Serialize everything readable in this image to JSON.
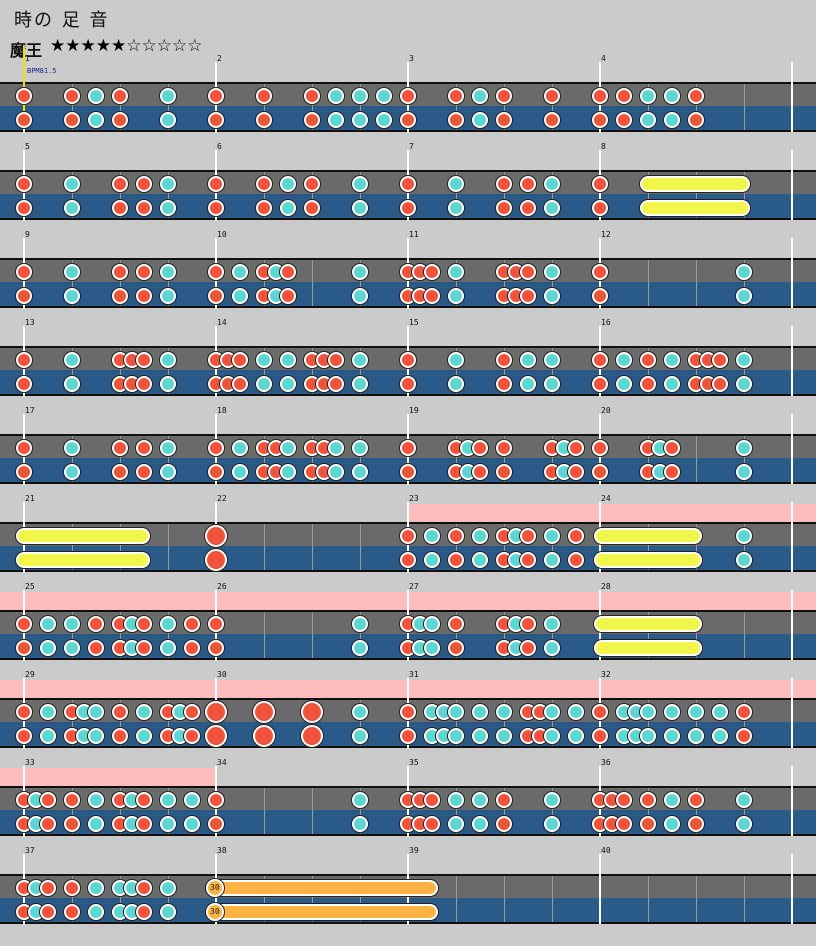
{
  "header": {
    "title": "時の 足 音",
    "difficulty": "魔王",
    "stars": "★★★★★☆☆☆☆☆"
  },
  "bpm_label": "BPM81.5",
  "balloon_label": "30",
  "colors": {
    "don": "#f0533c",
    "ka": "#5dd6d2",
    "roll": "#f2f54a",
    "balloon": "#fbb443",
    "gogo": "#fdbcbc"
  },
  "rows": [
    {
      "measures": [
        1,
        2,
        3,
        4
      ],
      "gogo": [],
      "notes": [
        [
          "d",
          24
        ],
        [
          "d",
          72
        ],
        [
          "k",
          96
        ],
        [
          "d",
          120
        ],
        [
          "k",
          168
        ],
        [
          "d",
          216
        ],
        [
          "d",
          264
        ],
        [
          "d",
          312
        ],
        [
          "k",
          336
        ],
        [
          "k",
          360
        ],
        [
          "k",
          384
        ],
        [
          "d",
          408
        ],
        [
          "d",
          456
        ],
        [
          "k",
          480
        ],
        [
          "d",
          504
        ],
        [
          "d",
          552
        ],
        [
          "d",
          600
        ],
        [
          "d",
          624
        ],
        [
          "k",
          648
        ],
        [
          "k",
          672
        ],
        [
          "d",
          696
        ]
      ],
      "rolls": [],
      "bignotes": []
    },
    {
      "measures": [
        5,
        6,
        7,
        8
      ],
      "gogo": [],
      "notes": [
        [
          "d",
          24
        ],
        [
          "k",
          72
        ],
        [
          "d",
          120
        ],
        [
          "d",
          144
        ],
        [
          "k",
          168
        ],
        [
          "d",
          216
        ],
        [
          "d",
          264
        ],
        [
          "k",
          288
        ],
        [
          "d",
          312
        ],
        [
          "k",
          360
        ],
        [
          "d",
          408
        ],
        [
          "k",
          456
        ],
        [
          "d",
          504
        ],
        [
          "d",
          528
        ],
        [
          "k",
          552
        ],
        [
          "d",
          600
        ]
      ],
      "rolls": [
        [
          "yellow",
          640,
          750
        ]
      ],
      "bignotes": []
    },
    {
      "measures": [
        9,
        10,
        11,
        12
      ],
      "gogo": [],
      "notes": [
        [
          "d",
          24
        ],
        [
          "k",
          72
        ],
        [
          "d",
          120
        ],
        [
          "d",
          144
        ],
        [
          "k",
          168
        ],
        [
          "d",
          216
        ],
        [
          "k",
          240
        ],
        [
          "d",
          264
        ],
        [
          "k",
          276
        ],
        [
          "d",
          288
        ],
        [
          "k",
          360
        ],
        [
          "d",
          408
        ],
        [
          "d",
          420
        ],
        [
          "d",
          432
        ],
        [
          "k",
          456
        ],
        [
          "d",
          504
        ],
        [
          "d",
          516
        ],
        [
          "d",
          528
        ],
        [
          "k",
          552
        ],
        [
          "d",
          600
        ],
        [
          "k",
          744
        ]
      ],
      "rolls": [],
      "bignotes": []
    },
    {
      "measures": [
        13,
        14,
        15,
        16
      ],
      "gogo": [],
      "notes": [
        [
          "d",
          24
        ],
        [
          "k",
          72
        ],
        [
          "d",
          120
        ],
        [
          "d",
          132
        ],
        [
          "d",
          144
        ],
        [
          "k",
          168
        ],
        [
          "d",
          216
        ],
        [
          "d",
          228
        ],
        [
          "d",
          240
        ],
        [
          "k",
          264
        ],
        [
          "k",
          288
        ],
        [
          "d",
          312
        ],
        [
          "d",
          324
        ],
        [
          "d",
          336
        ],
        [
          "k",
          360
        ],
        [
          "d",
          408
        ],
        [
          "k",
          456
        ],
        [
          "d",
          504
        ],
        [
          "k",
          528
        ],
        [
          "k",
          552
        ],
        [
          "d",
          600
        ],
        [
          "k",
          624
        ],
        [
          "d",
          648
        ],
        [
          "k",
          672
        ],
        [
          "d",
          696
        ],
        [
          "d",
          708
        ],
        [
          "d",
          720
        ],
        [
          "k",
          744
        ]
      ],
      "rolls": [],
      "bignotes": []
    },
    {
      "measures": [
        17,
        18,
        19,
        20
      ],
      "gogo": [],
      "notes": [
        [
          "d",
          24
        ],
        [
          "k",
          72
        ],
        [
          "d",
          120
        ],
        [
          "d",
          144
        ],
        [
          "k",
          168
        ],
        [
          "d",
          216
        ],
        [
          "k",
          240
        ],
        [
          "d",
          264
        ],
        [
          "d",
          276
        ],
        [
          "k",
          288
        ],
        [
          "d",
          312
        ],
        [
          "d",
          324
        ],
        [
          "k",
          336
        ],
        [
          "k",
          360
        ],
        [
          "d",
          408
        ],
        [
          "d",
          456
        ],
        [
          "k",
          468
        ],
        [
          "d",
          480
        ],
        [
          "d",
          504
        ],
        [
          "d",
          552
        ],
        [
          "k",
          564
        ],
        [
          "d",
          576
        ],
        [
          "d",
          600
        ],
        [
          "d",
          648
        ],
        [
          "k",
          660
        ],
        [
          "d",
          672
        ],
        [
          "k",
          744
        ]
      ],
      "rolls": [],
      "bignotes": []
    },
    {
      "measures": [
        21,
        22,
        23,
        24
      ],
      "gogo": [
        [
          408,
          816
        ]
      ],
      "notes": [
        [
          "d",
          408
        ],
        [
          "k",
          432
        ],
        [
          "d",
          456
        ],
        [
          "k",
          480
        ],
        [
          "d",
          504
        ],
        [
          "k",
          516
        ],
        [
          "d",
          528
        ],
        [
          "k",
          552
        ],
        [
          "d",
          576
        ],
        [
          "k",
          744
        ]
      ],
      "rolls": [
        [
          "yellow",
          16,
          150
        ],
        [
          "yellow",
          594,
          702
        ]
      ],
      "bignotes": [
        [
          "d",
          216
        ]
      ]
    },
    {
      "measures": [
        25,
        26,
        27,
        28
      ],
      "gogo": [
        [
          0,
          816
        ]
      ],
      "notes": [
        [
          "d",
          24
        ],
        [
          "k",
          48
        ],
        [
          "k",
          72
        ],
        [
          "d",
          96
        ],
        [
          "d",
          120
        ],
        [
          "k",
          132
        ],
        [
          "d",
          144
        ],
        [
          "k",
          168
        ],
        [
          "d",
          192
        ],
        [
          "d",
          216
        ],
        [
          "k",
          360
        ],
        [
          "d",
          408
        ],
        [
          "k",
          420
        ],
        [
          "k",
          432
        ],
        [
          "d",
          456
        ],
        [
          "d",
          504
        ],
        [
          "k",
          516
        ],
        [
          "d",
          528
        ],
        [
          "k",
          552
        ]
      ],
      "rolls": [
        [
          "yellow",
          594,
          702
        ]
      ],
      "bignotes": []
    },
    {
      "measures": [
        29,
        30,
        31,
        32
      ],
      "gogo": [
        [
          0,
          816
        ]
      ],
      "notes": [
        [
          "d",
          24
        ],
        [
          "k",
          48
        ],
        [
          "d",
          72
        ],
        [
          "k",
          84
        ],
        [
          "k",
          96
        ],
        [
          "d",
          120
        ],
        [
          "k",
          144
        ],
        [
          "d",
          168
        ],
        [
          "k",
          180
        ],
        [
          "d",
          192
        ],
        [
          "k",
          360
        ],
        [
          "d",
          408
        ],
        [
          "k",
          432
        ],
        [
          "k",
          444
        ],
        [
          "k",
          456
        ],
        [
          "k",
          480
        ],
        [
          "k",
          504
        ],
        [
          "d",
          528
        ],
        [
          "d",
          540
        ],
        [
          "k",
          552
        ],
        [
          "k",
          576
        ],
        [
          "d",
          600
        ],
        [
          "k",
          624
        ],
        [
          "k",
          636
        ],
        [
          "k",
          648
        ],
        [
          "k",
          672
        ],
        [
          "k",
          696
        ],
        [
          "k",
          720
        ],
        [
          "d",
          744
        ]
      ],
      "rolls": [],
      "bignotes": [
        [
          "d",
          216
        ],
        [
          "d",
          264
        ],
        [
          "d",
          312
        ]
      ]
    },
    {
      "measures": [
        33,
        34,
        35,
        36
      ],
      "gogo": [
        [
          0,
          216
        ]
      ],
      "notes": [
        [
          "d",
          24
        ],
        [
          "k",
          36
        ],
        [
          "d",
          48
        ],
        [
          "d",
          72
        ],
        [
          "k",
          96
        ],
        [
          "d",
          120
        ],
        [
          "k",
          132
        ],
        [
          "d",
          144
        ],
        [
          "k",
          168
        ],
        [
          "k",
          192
        ],
        [
          "d",
          216
        ],
        [
          "k",
          360
        ],
        [
          "d",
          408
        ],
        [
          "d",
          420
        ],
        [
          "d",
          432
        ],
        [
          "k",
          456
        ],
        [
          "k",
          480
        ],
        [
          "d",
          504
        ],
        [
          "k",
          552
        ],
        [
          "d",
          600
        ],
        [
          "d",
          612
        ],
        [
          "d",
          624
        ],
        [
          "d",
          648
        ],
        [
          "k",
          672
        ],
        [
          "d",
          696
        ],
        [
          "k",
          744
        ]
      ],
      "rolls": [],
      "bignotes": []
    },
    {
      "measures": [
        37,
        38,
        39,
        40
      ],
      "gogo": [],
      "notes": [
        [
          "d",
          24
        ],
        [
          "k",
          36
        ],
        [
          "d",
          48
        ],
        [
          "d",
          72
        ],
        [
          "k",
          96
        ],
        [
          "k",
          120
        ],
        [
          "k",
          132
        ],
        [
          "d",
          144
        ],
        [
          "k",
          168
        ]
      ],
      "rolls": [
        [
          "orange",
          206,
          438
        ]
      ],
      "bignotes": []
    }
  ]
}
